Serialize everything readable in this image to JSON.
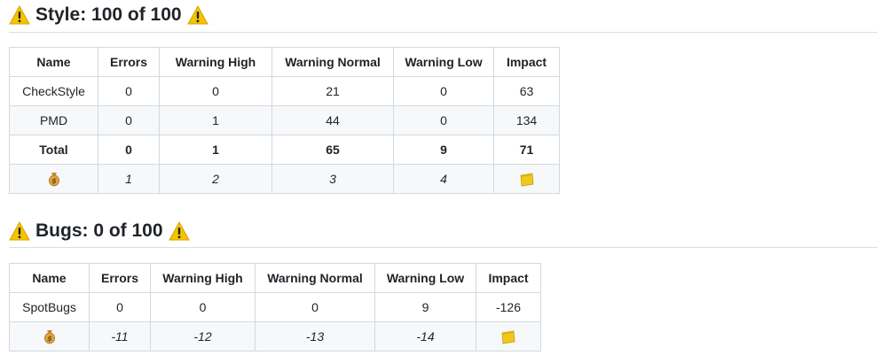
{
  "style_section": {
    "title": "Style: 100 of 100",
    "columns": [
      "Name",
      "Errors",
      "Warning High",
      "Warning Normal",
      "Warning Low",
      "Impact"
    ],
    "rows": [
      {
        "name": "CheckStyle",
        "errors": "0",
        "high": "0",
        "normal": "21",
        "low": "0",
        "impact": "63"
      },
      {
        "name": "PMD",
        "errors": "0",
        "high": "1",
        "normal": "44",
        "low": "0",
        "impact": "134"
      }
    ],
    "total": {
      "name": "Total",
      "errors": "0",
      "high": "1",
      "normal": "65",
      "low": "9",
      "impact": "71"
    },
    "cost": {
      "icon": "money-bag-icon",
      "errors": "1",
      "high": "2",
      "normal": "3",
      "low": "4",
      "impact_icon": "notepad-icon"
    }
  },
  "bugs_section": {
    "title": "Bugs: 0 of 100",
    "columns": [
      "Name",
      "Errors",
      "Warning High",
      "Warning Normal",
      "Warning Low",
      "Impact"
    ],
    "rows": [
      {
        "name": "SpotBugs",
        "errors": "0",
        "high": "0",
        "normal": "0",
        "low": "9",
        "impact": "-126"
      }
    ],
    "cost": {
      "icon": "money-bag-icon",
      "errors": "-11",
      "high": "-12",
      "normal": "-13",
      "low": "-14",
      "impact_icon": "notepad-icon"
    }
  },
  "colors": {
    "warning": "#f5c400",
    "border": "#d1d9e0",
    "alt_row": "#f6f8fa"
  }
}
